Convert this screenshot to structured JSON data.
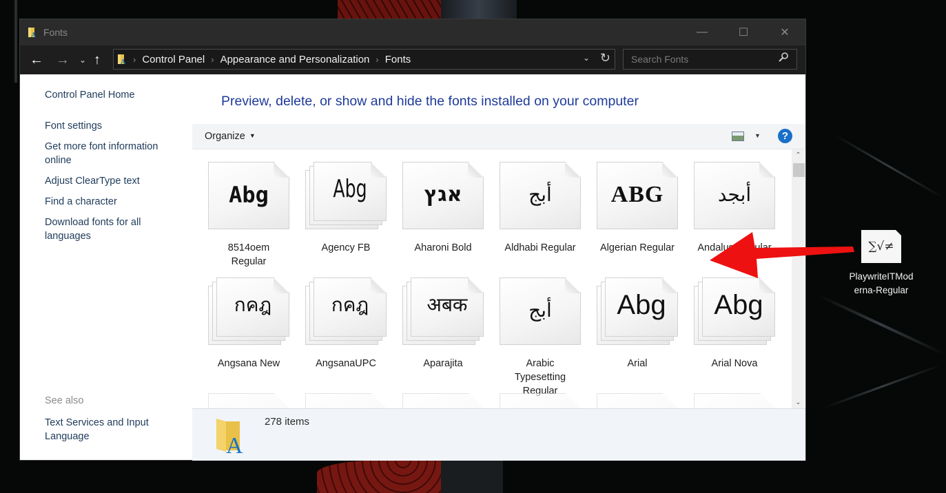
{
  "window": {
    "title": "Fonts",
    "controls": {
      "minimize": "—",
      "maximize": "☐",
      "close": "✕"
    }
  },
  "navigation": {
    "back": "←",
    "forward": "→",
    "recent": "⌄",
    "up": "↑",
    "breadcrumb": [
      "Control Panel",
      "Appearance and Personalization",
      "Fonts"
    ],
    "separator": "›",
    "dropdown": "⌄",
    "refresh": "↻",
    "search_placeholder": "Search Fonts",
    "search_value": "",
    "search_icon": "⚲"
  },
  "sidebar": {
    "home": "Control Panel Home",
    "links": [
      "Font settings",
      "Get more font information online",
      "Adjust ClearType text",
      "Find a character",
      "Download fonts for all languages"
    ],
    "see_also_label": "See also",
    "see_also_links": [
      "Text Services and Input Language"
    ]
  },
  "main": {
    "heading": "Preview, delete, or show and hide the fonts installed on your computer",
    "toolbar": {
      "organize": "Organize",
      "organize_caret": "▼",
      "view_caret": "▼",
      "help": "?"
    },
    "fonts": [
      {
        "name": "8514oem Regular",
        "sample": "Abg",
        "style": "s-pixel",
        "stacked": false
      },
      {
        "name": "Agency FB",
        "sample": "Abg",
        "style": "s-cond",
        "stacked": true
      },
      {
        "name": "Aharoni Bold",
        "sample": "אגץ",
        "style": "s-heb",
        "stacked": false
      },
      {
        "name": "Aldhabi Regular",
        "sample": "أبج",
        "style": "s-serif",
        "stacked": false
      },
      {
        "name": "Algerian Regular",
        "sample": "ABG",
        "style": "s-alg",
        "stacked": false
      },
      {
        "name": "Andalus Regular",
        "sample": "أبجد",
        "style": "s-serif",
        "stacked": false
      },
      {
        "name": "Angsana New",
        "sample": "กคฎ",
        "style": "s-serif",
        "stacked": true
      },
      {
        "name": "AngsanaUPC",
        "sample": "กคฎ",
        "style": "s-serif",
        "stacked": true
      },
      {
        "name": "Aparajita",
        "sample": "अबक",
        "style": "s-serif",
        "stacked": true
      },
      {
        "name": "Arabic Typesetting Regular",
        "sample": "أبج",
        "style": "s-serif",
        "stacked": false
      },
      {
        "name": "Arial",
        "sample": "Abg",
        "style": "s-sans",
        "stacked": true
      },
      {
        "name": "Arial Nova",
        "sample": "Abg",
        "style": "s-sans",
        "stacked": true
      }
    ],
    "status": {
      "item_count": "278 items"
    },
    "scroll": {
      "up": "⌃",
      "down": "⌄"
    }
  },
  "desktop": {
    "file_icon_glyphs": "∑√≠",
    "file_label": "PlaywriteITModerna-Regular"
  },
  "annotation": {
    "arrow_color": "#ee1111"
  }
}
